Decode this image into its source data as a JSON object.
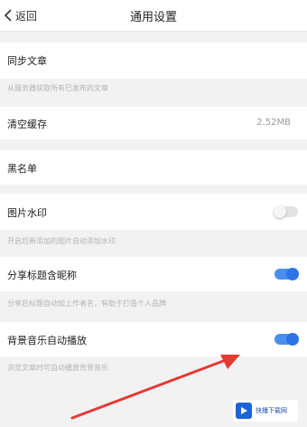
{
  "header": {
    "back_label": "返回",
    "title": "通用设置"
  },
  "rows": {
    "sync": {
      "label": "同步文章",
      "desc": "从服务器获取所有已发布的文章"
    },
    "cache": {
      "label": "清空缓存",
      "value": "2.52MB"
    },
    "blacklist": {
      "label": "黑名单"
    },
    "watermark": {
      "label": "图片水印",
      "desc": "开启后新添加的图片自动添加水印",
      "enabled": false
    },
    "share_nickname": {
      "label": "分享标题含昵称",
      "desc": "分享后标题自动加上作者名，有助于打造个人品牌",
      "enabled": true
    },
    "bgm_autoplay": {
      "label": "背景音乐自动播放",
      "desc": "浏览文章时可自动播放背景音乐",
      "enabled": true
    }
  },
  "site_watermark": {
    "text": "快播下载网"
  },
  "colors": {
    "accent": "#2f74e6",
    "arrow": "#e53935"
  }
}
